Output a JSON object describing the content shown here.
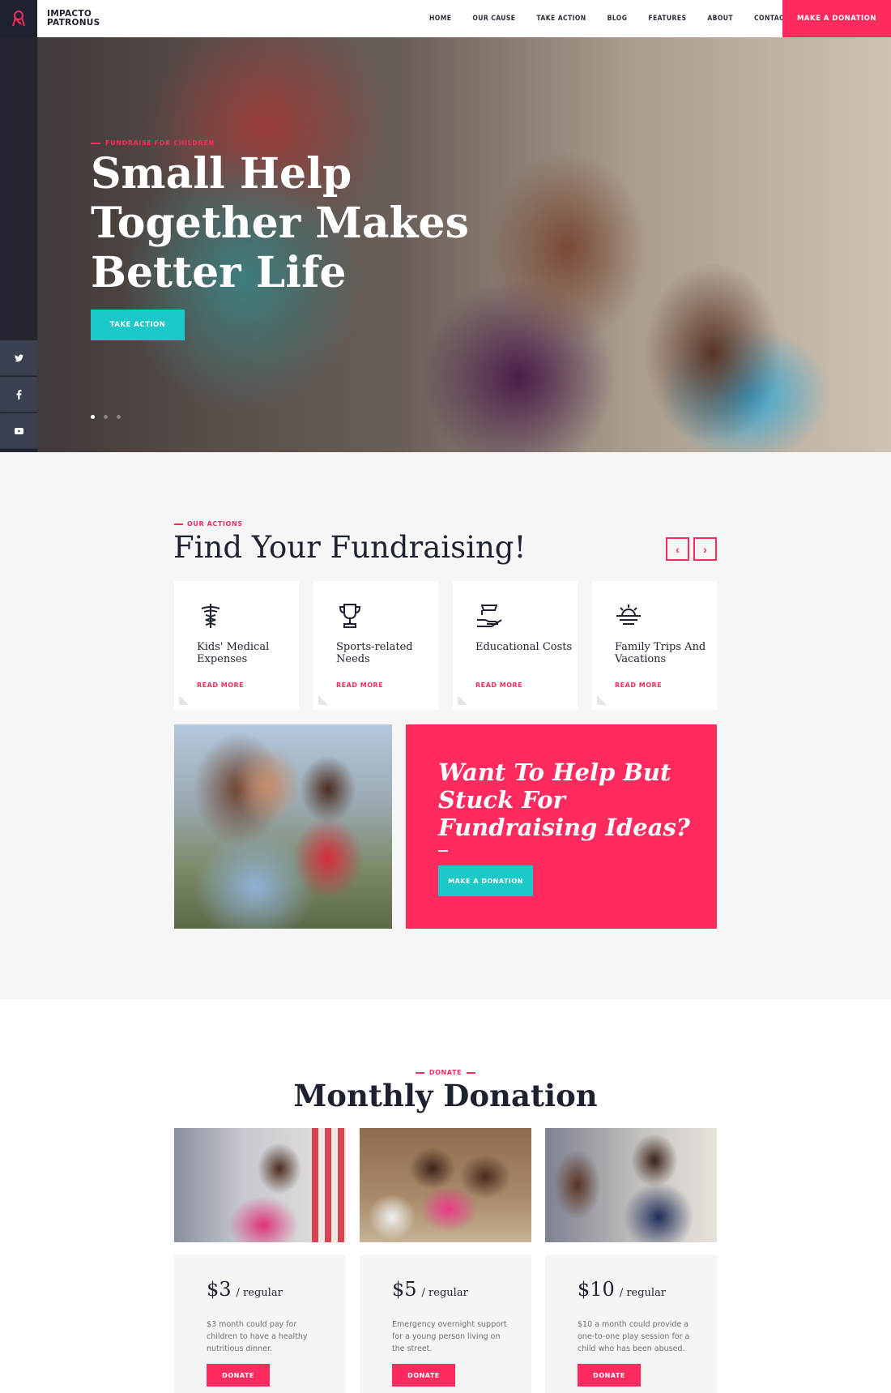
{
  "header": {
    "logo_line1": "IMPACTO",
    "logo_line2": "PATRONUS",
    "nav": [
      "HOME",
      "OUR CAUSE",
      "TAKE ACTION",
      "BLOG",
      "FEATURES",
      "ABOUT",
      "CONTACT"
    ],
    "cta": "MAKE A DONATION",
    "logo_icon": "ribbon-icon"
  },
  "hero": {
    "eyebrow": "FUNDRAISE FOR CHILDREN",
    "title": "Small Help Together Makes Better Life",
    "button": "TAKE ACTION",
    "social": [
      "twitter-icon",
      "facebook-icon",
      "youtube-icon"
    ],
    "slides": 3,
    "active_slide": 1
  },
  "actions": {
    "eyebrow": "OUR ACTIONS",
    "title": "Find Your Fundraising!",
    "cards": [
      {
        "title": "Kids' Medical Expenses",
        "link": "READ MORE",
        "icon": "caduceus-icon"
      },
      {
        "title": "Sports-related Needs",
        "link": "READ MORE",
        "icon": "trophy-icon"
      },
      {
        "title": "Educational Costs",
        "link": "READ MORE",
        "icon": "graduation-cap-hand-icon"
      },
      {
        "title": "Family Trips And Vacations",
        "link": "READ MORE",
        "icon": "sunset-icon"
      }
    ],
    "promo_title": "Want To Help But Stuck For Fundraising Ideas?",
    "promo_button": "MAKE A DONATION"
  },
  "donation": {
    "eyebrow": "DONATE",
    "title": "Monthly Donation",
    "plans": [
      {
        "amount": "$3",
        "unit": "/ regular",
        "desc": "$3 month could pay for children to have a healthy nutritious dinner.",
        "button": "DONATE"
      },
      {
        "amount": "$5",
        "unit": "/ regular",
        "desc": "Emergency overnight support for a young person living on the street.",
        "button": "DONATE"
      },
      {
        "amount": "$10",
        "unit": "/ regular",
        "desc": "$10 a month could provide a one-to-one play session for a child who has been abused.",
        "button": "DONATE"
      }
    ]
  },
  "colors": {
    "accent": "#ff2b5e",
    "teal": "#1ac9c8",
    "dark": "#1e2230"
  }
}
